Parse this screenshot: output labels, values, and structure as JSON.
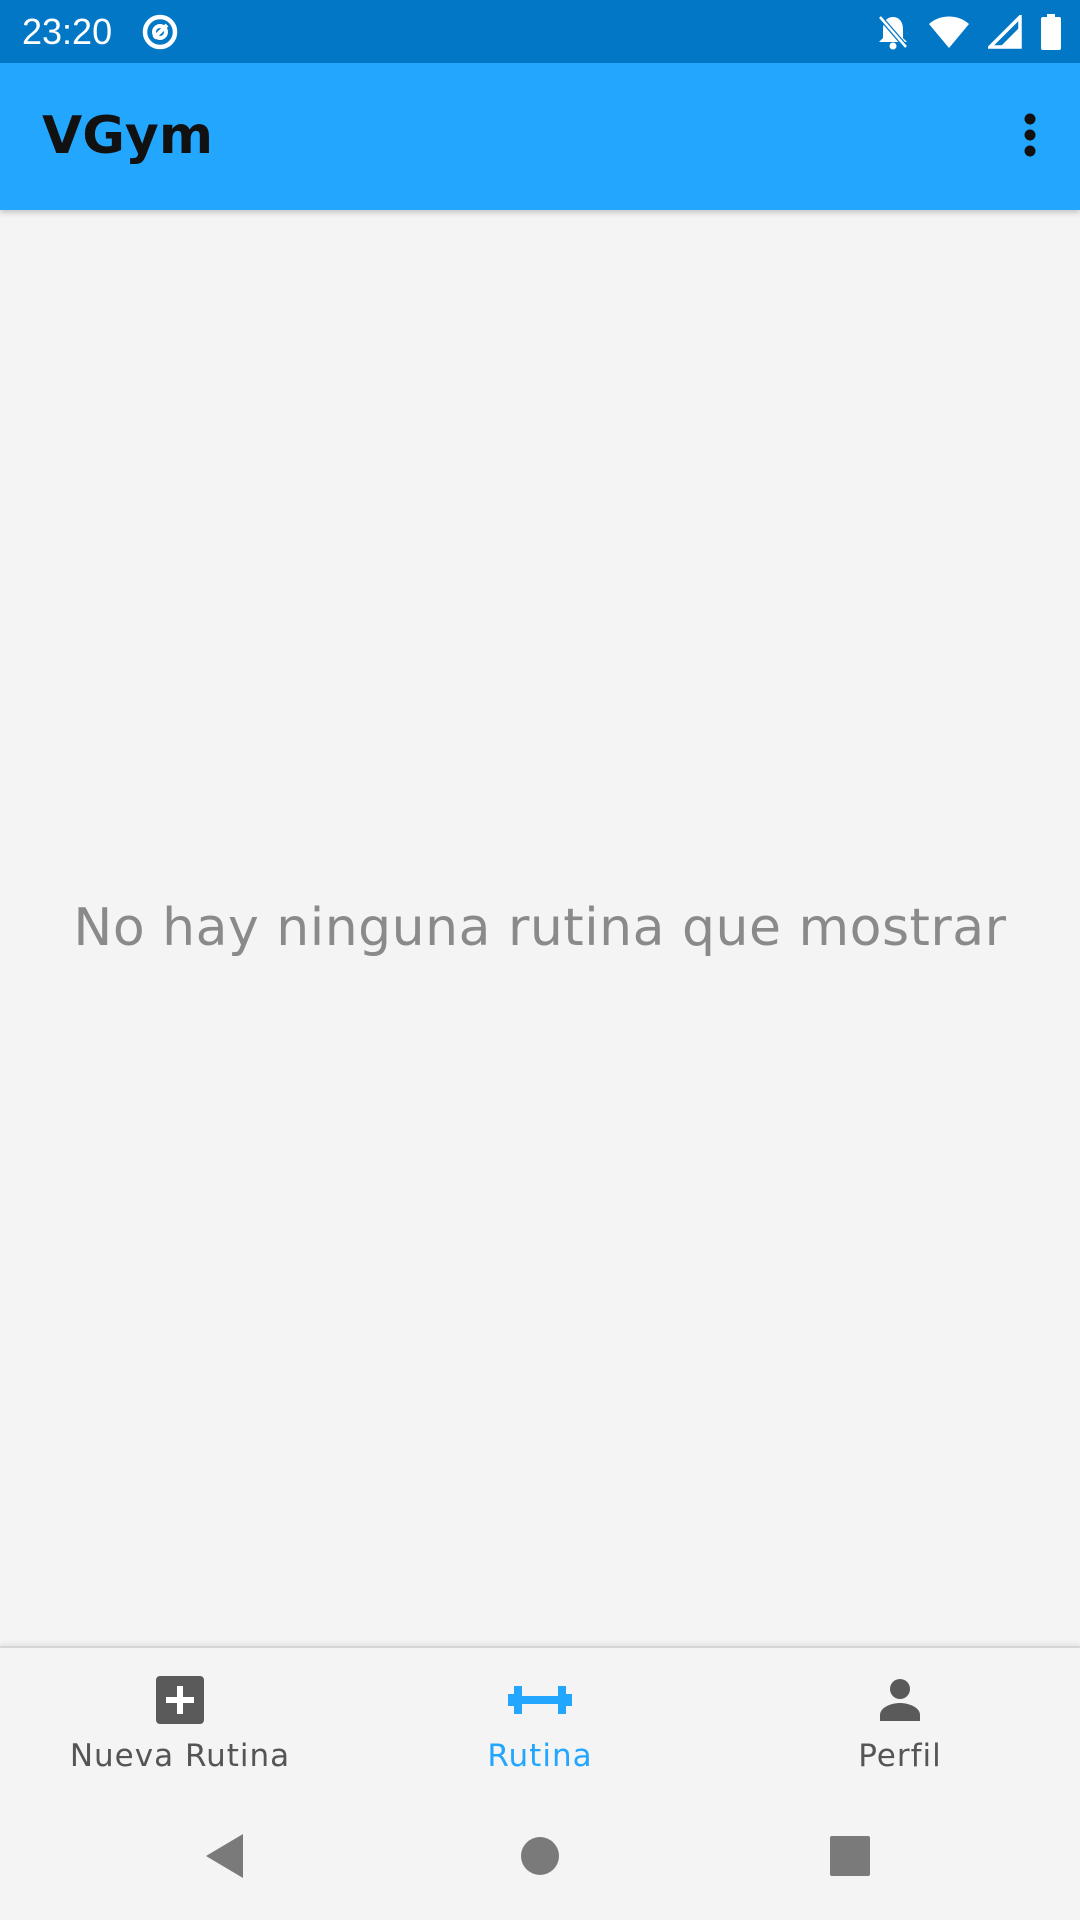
{
  "status_bar": {
    "time": "23:20",
    "left_icon": "at-sign-notification-icon",
    "right_icons": [
      "notifications-off-icon",
      "wifi-icon",
      "cellular-signal-icon",
      "battery-icon"
    ]
  },
  "app_bar": {
    "title": "VGym",
    "menu_icon": "more-vert-icon",
    "background_color": "#23a7fe"
  },
  "content": {
    "empty_message": "No hay ninguna rutina que mostrar"
  },
  "bottom_nav": {
    "items": [
      {
        "label": "Nueva Rutina",
        "icon": "add-box-icon",
        "active": false
      },
      {
        "label": "Rutina",
        "icon": "dumbbell-icon",
        "active": true
      },
      {
        "label": "Perfil",
        "icon": "person-icon",
        "active": false
      }
    ],
    "active_color": "#23a7fe",
    "inactive_color": "#555555"
  },
  "system_nav": {
    "buttons": [
      "back-icon",
      "home-icon",
      "recents-icon"
    ]
  }
}
